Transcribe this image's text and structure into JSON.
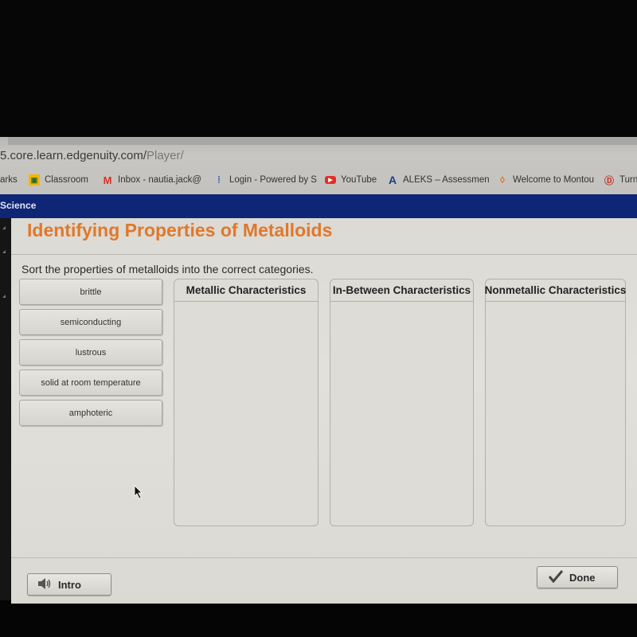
{
  "browser": {
    "url_host": "5.core.learn.edgenuity.com/",
    "url_path": "Player/",
    "bookmarks": [
      {
        "label": "arks",
        "icon": "none"
      },
      {
        "label": "Classroom",
        "icon": "classroom-icon",
        "color": "#f2b600"
      },
      {
        "label": "Inbox - nautia.jack@",
        "icon": "gmail-icon",
        "color": "#d93025"
      },
      {
        "label": "Login - Powered by S",
        "icon": "login-icon",
        "color": "#2b4fa8"
      },
      {
        "label": "YouTube",
        "icon": "youtube-icon",
        "color": "#e52d27"
      },
      {
        "label": "ALEKS – Assessmen",
        "icon": "aleks-icon",
        "color": "#1e3f8c"
      },
      {
        "label": "Welcome to Montou",
        "icon": "montour-icon",
        "color": "#e86a1c"
      },
      {
        "label": "Turn",
        "icon": "turnitin-icon",
        "color": "#c0392b"
      }
    ]
  },
  "site": {
    "subject": "Science",
    "bar_color": "#0f2576"
  },
  "activity": {
    "title": "Identifying Properties of Metalloids",
    "title_color": "#e0782b",
    "instructions": "Sort the properties of metalloids into the correct categories.",
    "items": [
      "brittle",
      "semiconducting",
      "lustrous",
      "solid at room temperature",
      "amphoteric"
    ],
    "categories": [
      {
        "label": "Metallic Characteristics",
        "items": []
      },
      {
        "label": "In-Between Characteristics",
        "items": []
      },
      {
        "label": "Nonmetallic Characteristics",
        "items": []
      }
    ]
  },
  "footer": {
    "intro_label": "Intro",
    "done_label": "Done"
  }
}
